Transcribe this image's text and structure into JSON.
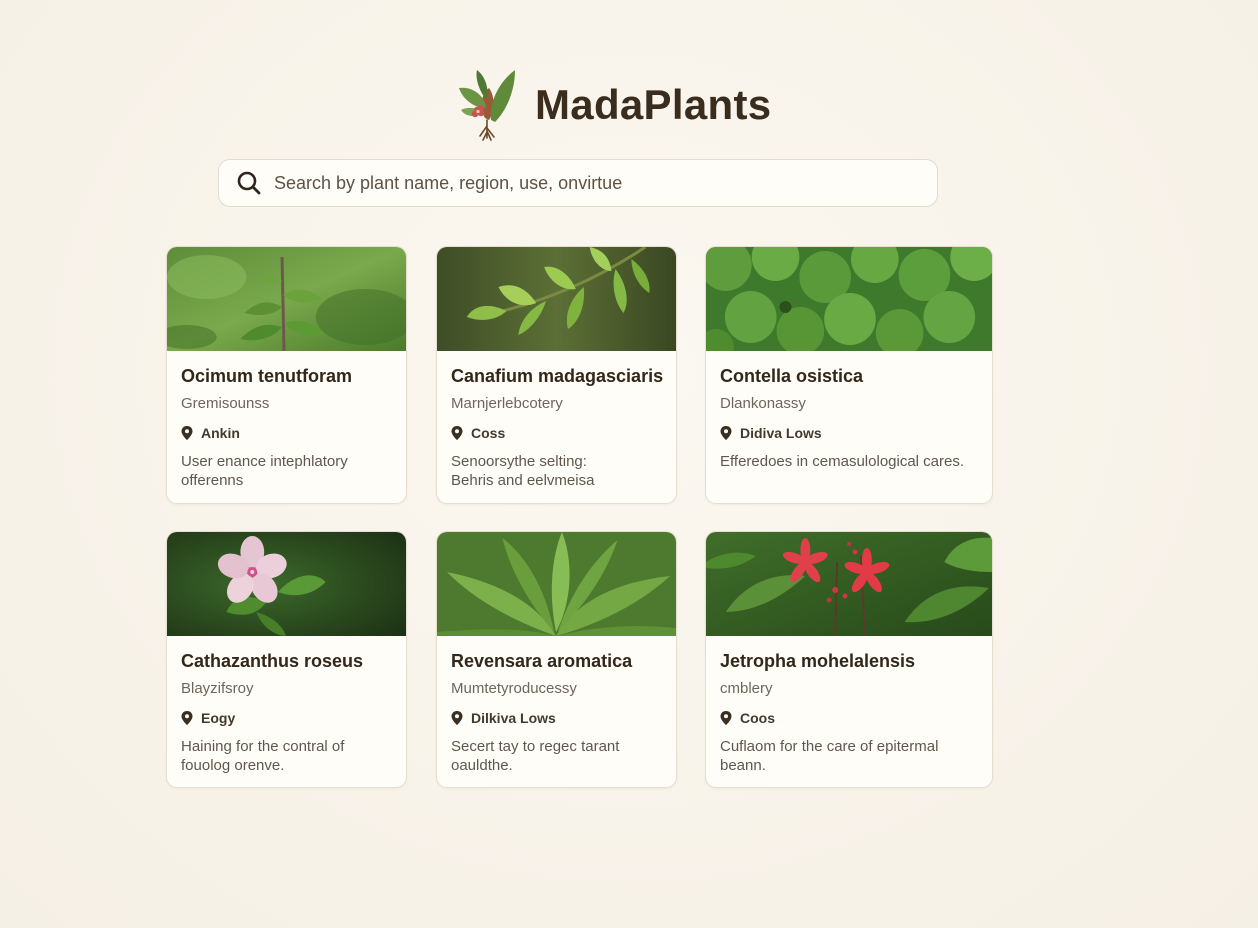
{
  "app": {
    "title": "MadaPlants",
    "logo_icon": "plant-leaves-logo-icon"
  },
  "search": {
    "placeholder": "Search by plant name, region, use, onvirtue",
    "icon": "search-icon"
  },
  "colors": {
    "background": "#f7f3ea",
    "card_background": "#fffdf8",
    "title_text": "#3a2d1d",
    "leaf_green": "#5f8a3a"
  },
  "cards": [
    {
      "title": "Ocimum tenutforam",
      "family": "Gremisounss",
      "region": "Ankin",
      "desc_line1": "User enance intephlatory",
      "desc_line2": "offerenns"
    },
    {
      "title": "Canafium madagasciaris",
      "family": "Marnjerlebcotery",
      "region": "Coss",
      "desc_line1": "Senoorsythe selting:",
      "desc_line2": "Behris and eelvmeisa"
    },
    {
      "title": "Contella osistica",
      "family": "Dlankonassy",
      "region": "Didiva Lows",
      "desc_line1": "Efferedoes in cemasulological cares.",
      "desc_line2": ""
    },
    {
      "title": "Cathazanthus roseus",
      "family": "Blayzifsroy",
      "region": "Eogy",
      "desc_line1": "Haining for the contral of",
      "desc_line2": "fouolog orenve."
    },
    {
      "title": "Revensara aromatica",
      "family": "Mumtetyroducessy",
      "region": "Dilkiva Lows",
      "desc_line1": "Secert tay to regec tarant",
      "desc_line2": "oauldthe."
    },
    {
      "title": "Jetropha mohelalensis",
      "family": "cmblery",
      "region": "Coos",
      "desc_line1": "Cuflaom for the care of epitermal",
      "desc_line2": "beann."
    }
  ]
}
